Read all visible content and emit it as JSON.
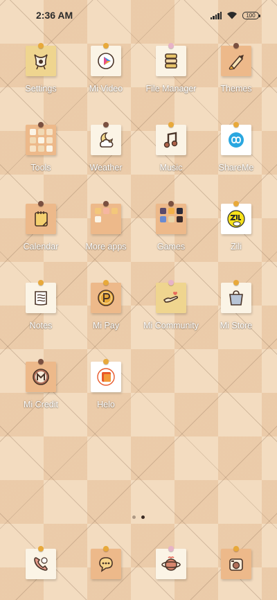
{
  "status_bar": {
    "time": "2:36 AM",
    "battery": "100"
  },
  "apps": [
    {
      "label": "Settings",
      "icon": "settings-icon",
      "note": "gold",
      "pin": "#e8a93a"
    },
    {
      "label": "Mi Video",
      "icon": "mi-video-icon",
      "note": "cream",
      "pin": "#e8a93a"
    },
    {
      "label": "File Manager",
      "icon": "file-manager-icon",
      "note": "cream",
      "pin": "#e7b3c8"
    },
    {
      "label": "Themes",
      "icon": "themes-icon",
      "note": "peach",
      "pin": "#7a5040"
    },
    {
      "label": "Tools",
      "icon": "tools-folder-icon",
      "note": "peach",
      "pin": "#7a5040"
    },
    {
      "label": "Weather",
      "icon": "weather-icon",
      "note": "cream",
      "pin": "#7a5040"
    },
    {
      "label": "Music",
      "icon": "music-icon",
      "note": "cream",
      "pin": "#e8a93a"
    },
    {
      "label": "ShareMe",
      "icon": "shareme-icon",
      "note": "white",
      "pin": "#e8a93a"
    },
    {
      "label": "Calendar",
      "icon": "calendar-icon",
      "note": "peach",
      "pin": "#7a5040"
    },
    {
      "label": "More apps",
      "icon": "more-apps-folder-icon",
      "note": "peach",
      "pin": "#7a5040"
    },
    {
      "label": "Games",
      "icon": "games-folder-icon",
      "note": "peach",
      "pin": "#7a5040"
    },
    {
      "label": "Zili",
      "icon": "zili-icon",
      "note": "white",
      "pin": "#e8a93a"
    },
    {
      "label": "Notes",
      "icon": "notes-icon",
      "note": "cream",
      "pin": "#e8a93a"
    },
    {
      "label": "Mi Pay",
      "icon": "mi-pay-icon",
      "note": "peach",
      "pin": "#e8a93a"
    },
    {
      "label": "Mi Community",
      "icon": "mi-community-icon",
      "note": "gold",
      "pin": "#e7b3c8"
    },
    {
      "label": "Mi Store",
      "icon": "mi-store-icon",
      "note": "cream",
      "pin": "#e8a93a"
    },
    {
      "label": "Mi Credit",
      "icon": "mi-credit-icon",
      "note": "peach",
      "pin": "#7a5040"
    },
    {
      "label": "Helo",
      "icon": "helo-icon",
      "note": "white",
      "pin": "#e8a93a"
    }
  ],
  "dock": [
    {
      "icon": "phone-icon",
      "note": "cream",
      "pin": "#e8a93a"
    },
    {
      "icon": "messages-icon",
      "note": "peach",
      "pin": "#e8a93a"
    },
    {
      "icon": "browser-icon",
      "note": "cream",
      "pin": "#e7b3c8"
    },
    {
      "icon": "camera-icon",
      "note": "peach",
      "pin": "#e8a93a"
    }
  ],
  "page_indicator": {
    "pages": 2,
    "current": 2
  }
}
